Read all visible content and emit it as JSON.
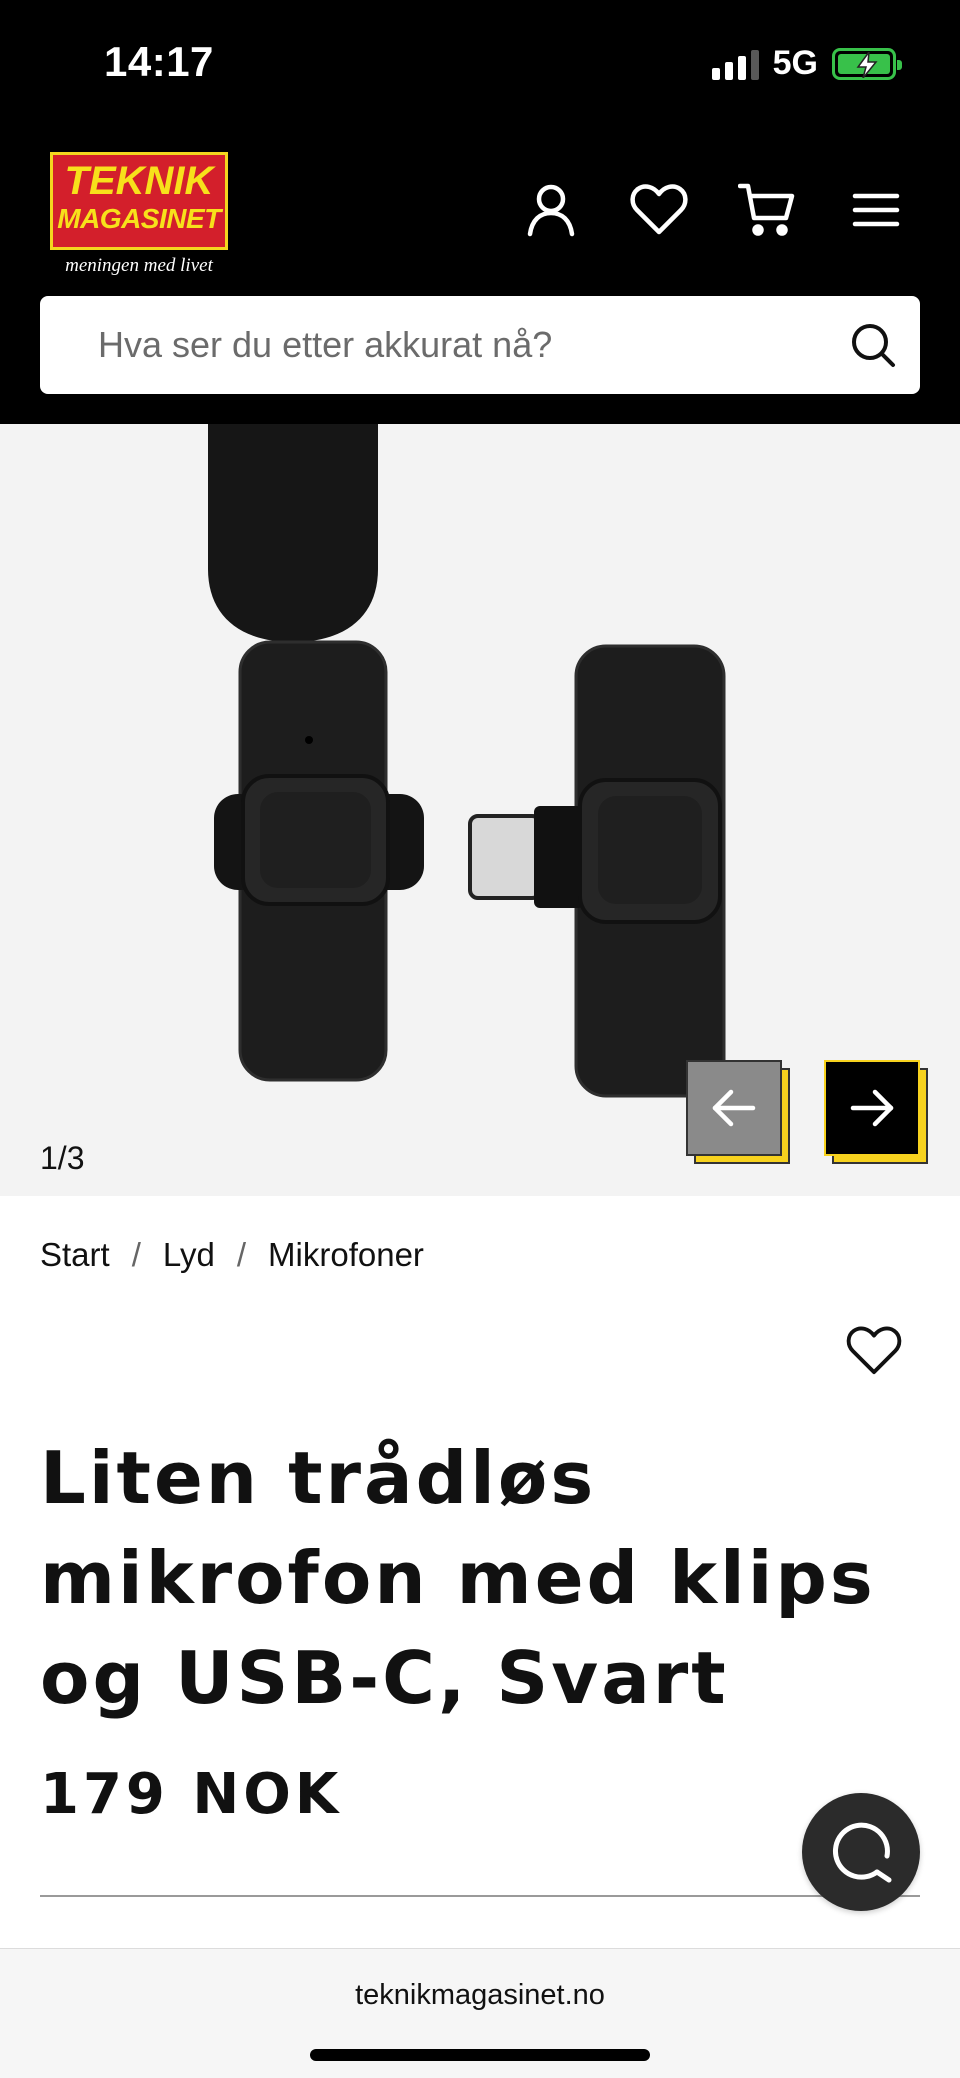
{
  "status_bar": {
    "time": "14:17",
    "network": "5G"
  },
  "header": {
    "logo": {
      "line1": "TEKNIK",
      "line2": "MAGASINET",
      "tagline": "meningen med livet"
    },
    "icons": [
      "user-icon",
      "heart-icon",
      "cart-icon",
      "menu-icon"
    ]
  },
  "search": {
    "placeholder": "Hva ser du etter akkurat nå?"
  },
  "gallery": {
    "counter": "1/3"
  },
  "breadcrumb": {
    "items": [
      "Start",
      "Lyd",
      "Mikrofoner"
    ],
    "separator": "/"
  },
  "product": {
    "title": "Liten trådløs mikrofon med klips og USB-C, Svart",
    "price": "179 NOK"
  },
  "browser": {
    "url": "teknikmagasinet.no"
  },
  "colors": {
    "header_bg": "#000000",
    "accent_yellow": "#f7d21e",
    "logo_red": "#d31f2b",
    "battery_green": "#38c14a"
  }
}
